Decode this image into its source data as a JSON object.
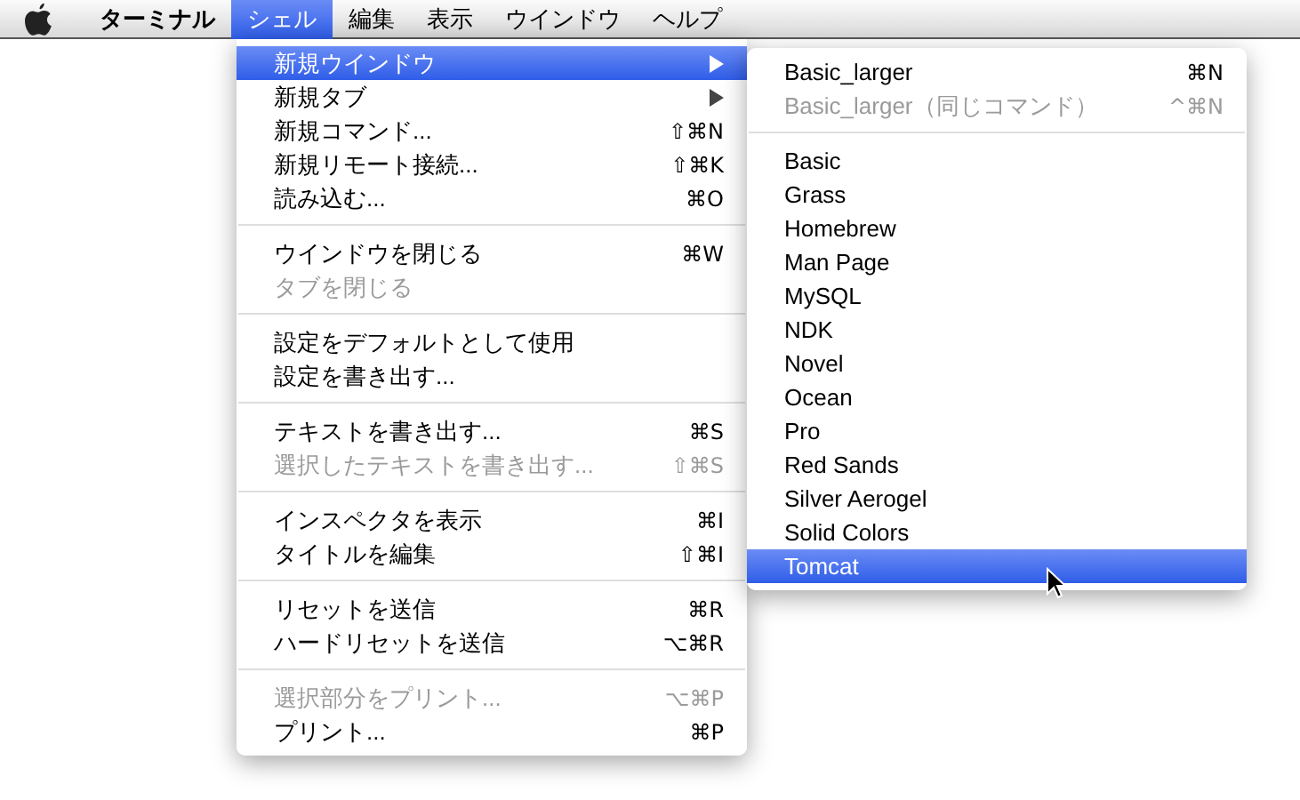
{
  "menu_bar": {
    "items": [
      {
        "label": "ターミナル",
        "selected": false,
        "bold": true
      },
      {
        "label": "シェル",
        "selected": true,
        "bold": false
      },
      {
        "label": "編集",
        "selected": false,
        "bold": false
      },
      {
        "label": "表示",
        "selected": false,
        "bold": false
      },
      {
        "label": "ウインドウ",
        "selected": false,
        "bold": false
      },
      {
        "label": "ヘルプ",
        "selected": false,
        "bold": false
      }
    ]
  },
  "shell_menu": {
    "sections": [
      {
        "items": [
          {
            "label": "新規ウインドウ",
            "has_submenu": true,
            "disabled": false,
            "selected": true
          },
          {
            "label": "新規タブ",
            "has_submenu": true,
            "disabled": false,
            "selected": false
          },
          {
            "label": "新規コマンド...",
            "shortcut": "⇧⌘N",
            "has_submenu": false,
            "disabled": false,
            "selected": false
          },
          {
            "label": "新規リモート接続...",
            "shortcut": "⇧⌘K",
            "has_submenu": false,
            "disabled": false,
            "selected": false
          },
          {
            "label": "読み込む...",
            "shortcut": "⌘O",
            "has_submenu": false,
            "disabled": false,
            "selected": false
          }
        ]
      },
      {
        "items": [
          {
            "label": "ウインドウを閉じる",
            "shortcut": "⌘W",
            "has_submenu": false,
            "disabled": false,
            "selected": false
          },
          {
            "label": "タブを閉じる",
            "has_submenu": false,
            "disabled": true,
            "selected": false
          }
        ]
      },
      {
        "items": [
          {
            "label": "設定をデフォルトとして使用",
            "has_submenu": false,
            "disabled": false,
            "selected": false
          },
          {
            "label": "設定を書き出す...",
            "has_submenu": false,
            "disabled": false,
            "selected": false
          }
        ]
      },
      {
        "items": [
          {
            "label": "テキストを書き出す...",
            "shortcut": "⌘S",
            "has_submenu": false,
            "disabled": false,
            "selected": false
          },
          {
            "label": "選択したテキストを書き出す...",
            "shortcut": "⇧⌘S",
            "has_submenu": false,
            "disabled": true,
            "selected": false
          }
        ]
      },
      {
        "items": [
          {
            "label": "インスペクタを表示",
            "shortcut": "⌘I",
            "has_submenu": false,
            "disabled": false,
            "selected": false
          },
          {
            "label": "タイトルを編集",
            "shortcut": "⇧⌘I",
            "has_submenu": false,
            "disabled": false,
            "selected": false
          }
        ]
      },
      {
        "items": [
          {
            "label": "リセットを送信",
            "shortcut": "⌘R",
            "has_submenu": false,
            "disabled": false,
            "selected": false
          },
          {
            "label": "ハードリセットを送信",
            "shortcut": "⌥⌘R",
            "has_submenu": false,
            "disabled": false,
            "selected": false
          }
        ]
      },
      {
        "items": [
          {
            "label": "選択部分をプリント...",
            "shortcut": "⌥⌘P",
            "has_submenu": false,
            "disabled": true,
            "selected": false
          },
          {
            "label": "プリント...",
            "shortcut": "⌘P",
            "has_submenu": false,
            "disabled": false,
            "selected": false
          }
        ]
      }
    ]
  },
  "new_window_submenu": {
    "sections": [
      {
        "items": [
          {
            "label": "Basic_larger",
            "shortcut": "⌘N",
            "disabled": false,
            "selected": false
          },
          {
            "label": "Basic_larger（同じコマンド）",
            "shortcut": "^⌘N",
            "disabled": true,
            "selected": false
          }
        ]
      },
      {
        "items": [
          {
            "label": "Basic",
            "disabled": false,
            "selected": false
          },
          {
            "label": "Grass",
            "disabled": false,
            "selected": false
          },
          {
            "label": "Homebrew",
            "disabled": false,
            "selected": false
          },
          {
            "label": "Man Page",
            "disabled": false,
            "selected": false
          },
          {
            "label": "MySQL",
            "disabled": false,
            "selected": false
          },
          {
            "label": "NDK",
            "disabled": false,
            "selected": false
          },
          {
            "label": "Novel",
            "disabled": false,
            "selected": false
          },
          {
            "label": "Ocean",
            "disabled": false,
            "selected": false
          },
          {
            "label": "Pro",
            "disabled": false,
            "selected": false
          },
          {
            "label": "Red Sands",
            "disabled": false,
            "selected": false
          },
          {
            "label": "Silver Aerogel",
            "disabled": false,
            "selected": false
          },
          {
            "label": "Solid Colors",
            "disabled": false,
            "selected": false
          },
          {
            "label": "Tomcat",
            "disabled": false,
            "selected": true
          }
        ]
      }
    ]
  }
}
